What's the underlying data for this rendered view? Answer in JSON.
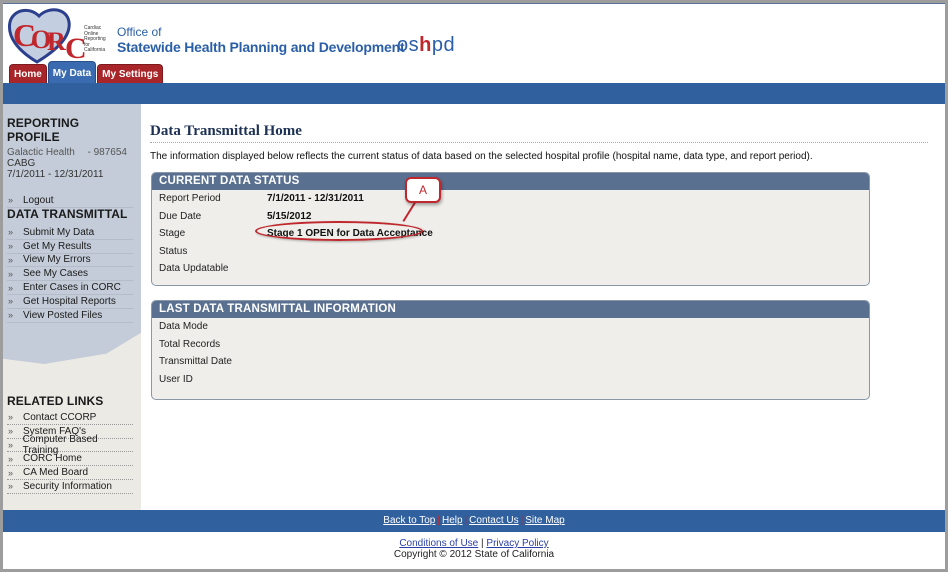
{
  "header": {
    "logo_text": "CORC",
    "logo_subtitle": [
      "Cardiac",
      "Online",
      "Reporting",
      "for",
      "California"
    ],
    "office_line": "Office of",
    "agency_name": "Statewide Health Planning and Development",
    "agency_logo": {
      "pre": "os",
      "mid": "h",
      "post": "pd"
    },
    "colors": {
      "brand_blue": "#31609f",
      "brand_red": "#a8262a"
    }
  },
  "tabs": [
    {
      "label": "Home",
      "active": false
    },
    {
      "label": "My Data",
      "active": true
    },
    {
      "label": "My Settings",
      "active": false
    }
  ],
  "sidebar": {
    "profile": {
      "heading": "REPORTING PROFILE",
      "hospital": "Galactic Health",
      "hospital_id": "- 987654",
      "data_type": "CABG",
      "period": "7/1/2011 - 12/31/2011",
      "logout_label": "Logout"
    },
    "transmittal": {
      "heading": "DATA TRANSMITTAL",
      "items": [
        "Submit My Data",
        "Get My Results",
        "View My Errors",
        "See My Cases",
        "Enter Cases in CORC",
        "Get Hospital Reports",
        "View Posted Files"
      ]
    },
    "related": {
      "heading": "RELATED LINKS",
      "items": [
        "Contact CCORP",
        "System FAQ's",
        "Computer Based Training",
        "CORC Home",
        "CA Med Board",
        "Security Information"
      ]
    },
    "arrow_glyph": "»"
  },
  "main": {
    "title": "Data Transmittal Home",
    "intro": "The information displayed below reflects the current status of data based on the selected hospital profile (hospital name, data type, and report period).",
    "current_status": {
      "heading": "CURRENT DATA STATUS",
      "rows": [
        {
          "label": "Report Period",
          "value": "7/1/2011 - 12/31/2011"
        },
        {
          "label": "Due Date",
          "value": "5/15/2012"
        },
        {
          "label": "Stage",
          "value": "Stage 1 OPEN for Data Acceptance"
        },
        {
          "label": "Status",
          "value": ""
        },
        {
          "label": "Data Updatable",
          "value": ""
        }
      ],
      "callout_label": "A"
    },
    "last_transmittal": {
      "heading": "LAST DATA TRANSMITTAL INFORMATION",
      "rows": [
        {
          "label": "Data Mode",
          "value": ""
        },
        {
          "label": "Total Records",
          "value": ""
        },
        {
          "label": "Transmittal Date",
          "value": ""
        },
        {
          "label": "User ID",
          "value": ""
        }
      ]
    }
  },
  "footer": {
    "nav": [
      "Back to Top",
      "Help",
      "Contact Us",
      "Site Map"
    ],
    "separator": "|",
    "conditions": "Conditions of Use",
    "privacy": "Privacy Policy",
    "copyright_prefix": "Copyright ©",
    "copyright_year": "2012",
    "copyright_suffix": "State of California"
  }
}
